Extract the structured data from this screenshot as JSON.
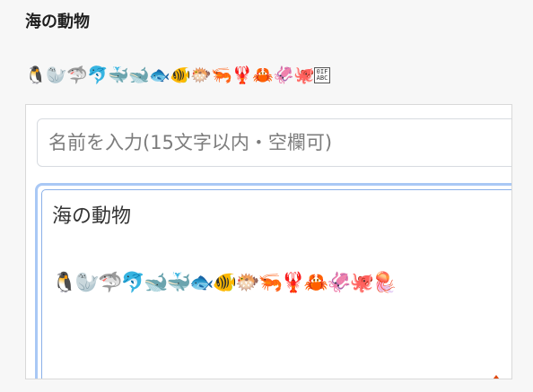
{
  "heading": "海の動物",
  "emoji_strip": [
    "🐧",
    "🦭",
    "🦈",
    "🐬",
    "🐳",
    "🐋",
    "🐟",
    "🐠",
    "🐡",
    "🦐",
    "🦞",
    "🦀",
    "🦑",
    "🐙"
  ],
  "font_tag": {
    "top": "0IF",
    "bottom": "ABC"
  },
  "name_input": {
    "placeholder": "名前を入力(15文字以内・空欄可)",
    "value": ""
  },
  "textarea": {
    "title": "海の動物",
    "emojis": [
      "🐧",
      "🦭",
      "🦈",
      "🐬",
      "🐋",
      "🐳",
      "🐟",
      "🐠",
      "🐡",
      "🦐",
      "🦞",
      "🦀",
      "🦑",
      "🐙",
      "🪼"
    ]
  },
  "colors": {
    "focus_border": "#a9c8f5",
    "drop": "#e0490f"
  }
}
